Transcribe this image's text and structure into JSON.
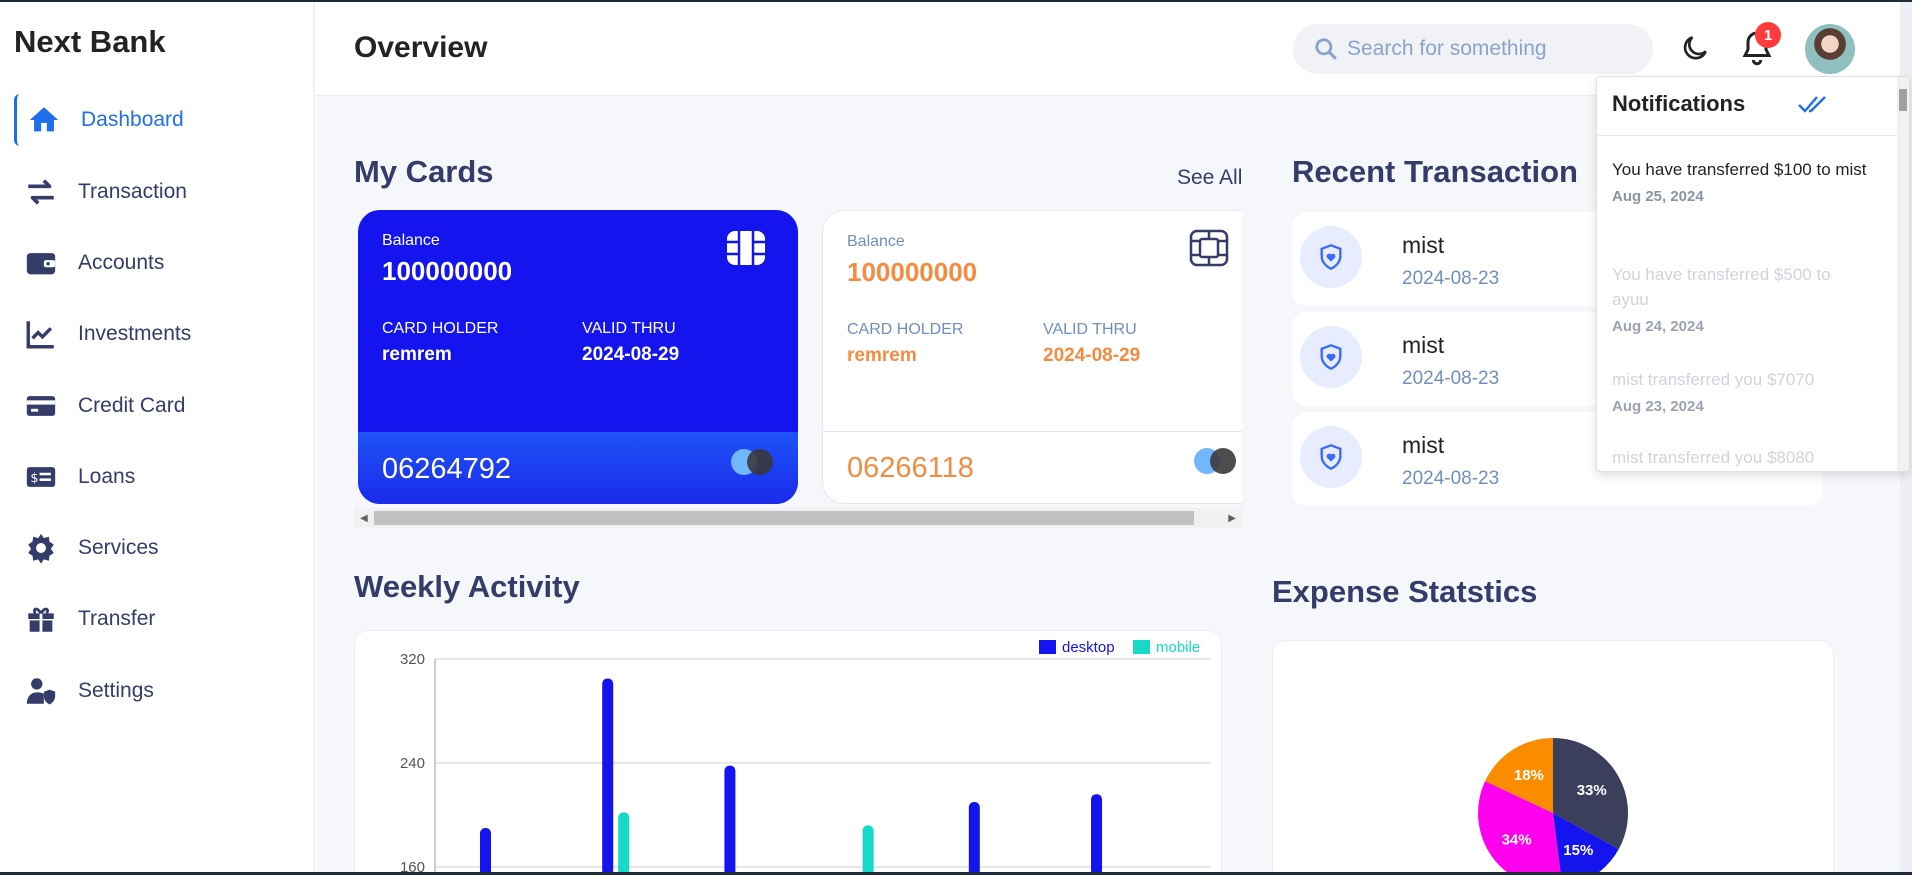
{
  "app": {
    "name": "Next Bank",
    "page_title": "Overview"
  },
  "sidebar": {
    "items": [
      {
        "label": "Dashboard",
        "icon": "home-icon",
        "active": true
      },
      {
        "label": "Transaction",
        "icon": "transfer-arrows-icon"
      },
      {
        "label": "Accounts",
        "icon": "wallet-icon"
      },
      {
        "label": "Investments",
        "icon": "chart-line-icon"
      },
      {
        "label": "Credit Card",
        "icon": "credit-card-icon"
      },
      {
        "label": "Loans",
        "icon": "money-bill-icon"
      },
      {
        "label": "Services",
        "icon": "gear-icon"
      },
      {
        "label": "Transfer",
        "icon": "gift-icon"
      },
      {
        "label": "Settings",
        "icon": "user-shield-icon"
      }
    ]
  },
  "header": {
    "search_placeholder": "Search for something",
    "notification_count": "1"
  },
  "my_cards": {
    "title": "My Cards",
    "see_all": "See All",
    "cards": [
      {
        "balance_label": "Balance",
        "balance": "100000000",
        "holder_label": "CARD HOLDER",
        "holder": "remrem",
        "valid_label": "VALID THRU",
        "valid": "2024-08-29",
        "number": "06264792"
      },
      {
        "balance_label": "Balance",
        "balance": "100000000",
        "holder_label": "CARD HOLDER",
        "holder": "remrem",
        "valid_label": "VALID THRU",
        "valid": "2024-08-29",
        "number": "06266118"
      }
    ]
  },
  "recent_transaction": {
    "title": "Recent Transaction",
    "items": [
      {
        "name": "mist",
        "date": "2024-08-23"
      },
      {
        "name": "mist",
        "date": "2024-08-23"
      },
      {
        "name": "mist",
        "date": "2024-08-23"
      }
    ]
  },
  "notifications": {
    "title": "Notifications",
    "items": [
      {
        "message": "You have transferred $100 to mist",
        "time": "Aug 25, 2024",
        "read": false
      },
      {
        "message": "You have transferred $500 to ayuu",
        "time": "Aug 24, 2024",
        "read": true
      },
      {
        "message": "mist transferred you $7070",
        "time": "Aug 23, 2024",
        "read": true
      },
      {
        "message": "mist transferred you $8080",
        "time": "",
        "read": true
      }
    ]
  },
  "weekly_activity": {
    "title": "Weekly Activity"
  },
  "expense_statistics": {
    "title": "Expense Statstics"
  },
  "colors": {
    "accent": "#1f6feb",
    "card_blue": "#1414ee",
    "orange": "#f68b3f",
    "desktop": "#1414ee",
    "mobile": "#16d9c9",
    "heading": "#343c6a"
  },
  "chart_data": [
    {
      "type": "bar",
      "title": "",
      "series": [
        {
          "name": "desktop",
          "color": "#1414ee",
          "values": [
            190,
            305,
            238,
            null,
            210,
            216
          ]
        },
        {
          "name": "mobile",
          "color": "#16d9c9",
          "values": [
            null,
            202,
            null,
            192,
            null,
            null
          ]
        }
      ],
      "y_ticks": [
        160,
        240,
        320
      ],
      "ylim": [
        160,
        320
      ],
      "legend": "top-right",
      "grid": true
    },
    {
      "type": "pie",
      "slices": [
        {
          "label": "33%",
          "value": 33,
          "color": "#3b3f5c"
        },
        {
          "label": "15%",
          "value": 15,
          "color": "#1414ee"
        },
        {
          "label": "34%",
          "value": 34,
          "color": "#ff00ee"
        },
        {
          "label": "18%",
          "value": 18,
          "color": "#fb8c00"
        }
      ]
    }
  ]
}
